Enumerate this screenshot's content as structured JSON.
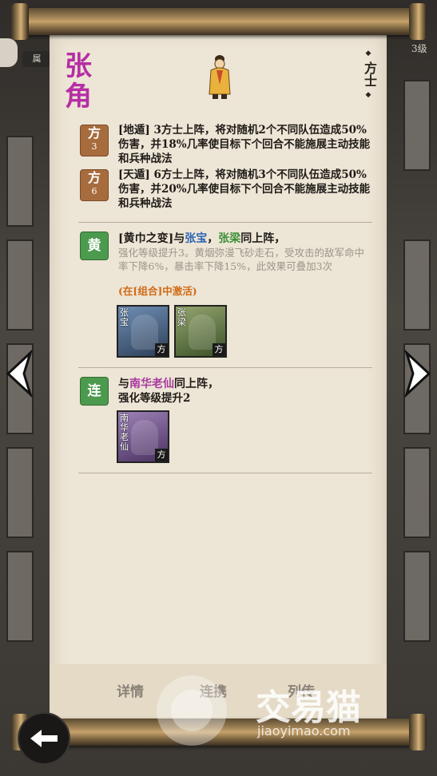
{
  "background": {
    "left_tag": "属",
    "right_tag": "3级"
  },
  "general": {
    "name": "张角",
    "class_label": "方士",
    "name_color": "#b52ea5"
  },
  "skills": [
    {
      "badge": "方",
      "level": "3",
      "text": "[地遁] 3方士上阵，将对随机2个不同队伍造成50%伤害，并18%几率使目标下个回合不能施展主动技能和兵种战法"
    },
    {
      "badge": "方",
      "level": "6",
      "text": "[天遁] 6方士上阵，将对随机3个不同队伍造成50%伤害，并20%几率使目标下个回合不能施展主动技能和兵种战法"
    }
  ],
  "combos": [
    {
      "badge": "黄",
      "title_prefix": "[黄巾之变]与",
      "partner1": "张宝",
      "sep": "，",
      "partner2": "张梁",
      "title_suffix": "同上阵，",
      "effect": "强化等级提升3。黄烟弥漫飞砂走石，受攻击的敌军命中率下降6%，暴击率下降15%，此效果可叠加3次",
      "activate_note": "(在[组合]中激活)",
      "cards": [
        {
          "name": "张宝",
          "cls": "方",
          "color": "#3e5a7c"
        },
        {
          "name": "张梁",
          "cls": "方",
          "color": "#4d6a3a"
        }
      ]
    },
    {
      "badge": "连",
      "title_prefix": "与",
      "partner1": "南华老仙",
      "title_suffix": "同上阵，",
      "effect": "强化等级提升2",
      "cards": [
        {
          "name": "南华老仙",
          "cls": "方",
          "color": "#6d4f86"
        }
      ]
    }
  ],
  "tabs": [
    "详情",
    "连携",
    "列传"
  ],
  "watermark": {
    "brand": "交易猫",
    "url": "jiaoyimao.com"
  },
  "colors": {
    "skill_badge": "#a76c3d",
    "combo_badge": "#4c9a4e",
    "activate": "#d06a16"
  }
}
